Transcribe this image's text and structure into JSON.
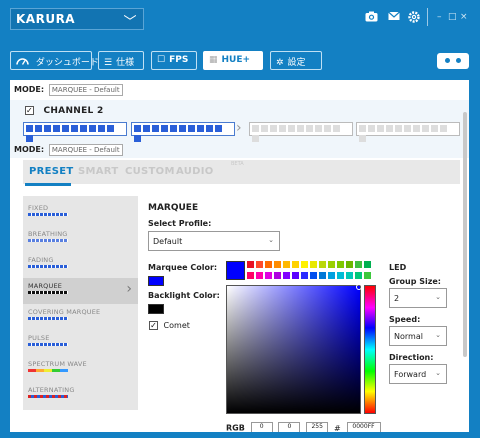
{
  "titlebar": {
    "device": "KARURA",
    "icons": [
      "camera-icon",
      "mail-icon",
      "gear-icon"
    ],
    "controls": [
      "–",
      "□",
      "×"
    ]
  },
  "tabs": [
    {
      "label": "ダッシュボード",
      "icon": "speedometer-icon"
    },
    {
      "label": "仕様",
      "icon": "list-icon"
    },
    {
      "label": "FPS",
      "icon": "square-icon"
    },
    {
      "label": "HUE+",
      "icon": "hue-grid-icon"
    },
    {
      "label": "設定",
      "icon": "gear-icon"
    }
  ],
  "mode1": {
    "label": "MODE:",
    "value": "MARQUEE - Default"
  },
  "channel": {
    "label": "CHANNEL 2",
    "checked": "✓"
  },
  "mode2": {
    "label": "MODE:",
    "value": "MARQUEE - Default"
  },
  "modetabs": [
    "PRESET",
    "SMART",
    "CUSTOM",
    "AUDIO"
  ],
  "beta": "BETA",
  "effects": [
    {
      "name": "FIXED"
    },
    {
      "name": "BREATHING"
    },
    {
      "name": "FADING"
    },
    {
      "name": "MARQUEE"
    },
    {
      "name": "COVERING MARQUEE"
    },
    {
      "name": "PULSE"
    },
    {
      "name": "SPECTRUM WAVE"
    },
    {
      "name": "ALTERNATING"
    }
  ],
  "panel": {
    "title": "MARQUEE",
    "select_profile_label": "Select Profile:",
    "profile": "Default",
    "marquee_color_label": "Marquee Color:",
    "backlight_color_label": "Backlight Color:",
    "comet_label": "Comet",
    "comet_checked": "✓",
    "led_label": "LED",
    "group_size_label": "Group Size:",
    "group_size": "2",
    "speed_label": "Speed:",
    "speed": "Normal",
    "direction_label": "Direction:",
    "direction": "Forward",
    "rgb_label": "RGB",
    "rgb": [
      "0",
      "0",
      "255"
    ],
    "hash": "#",
    "hex": "0000FF"
  },
  "colors": {
    "accent": "#1380c3",
    "marquee": "#0000ff",
    "backlight": "#000000"
  }
}
